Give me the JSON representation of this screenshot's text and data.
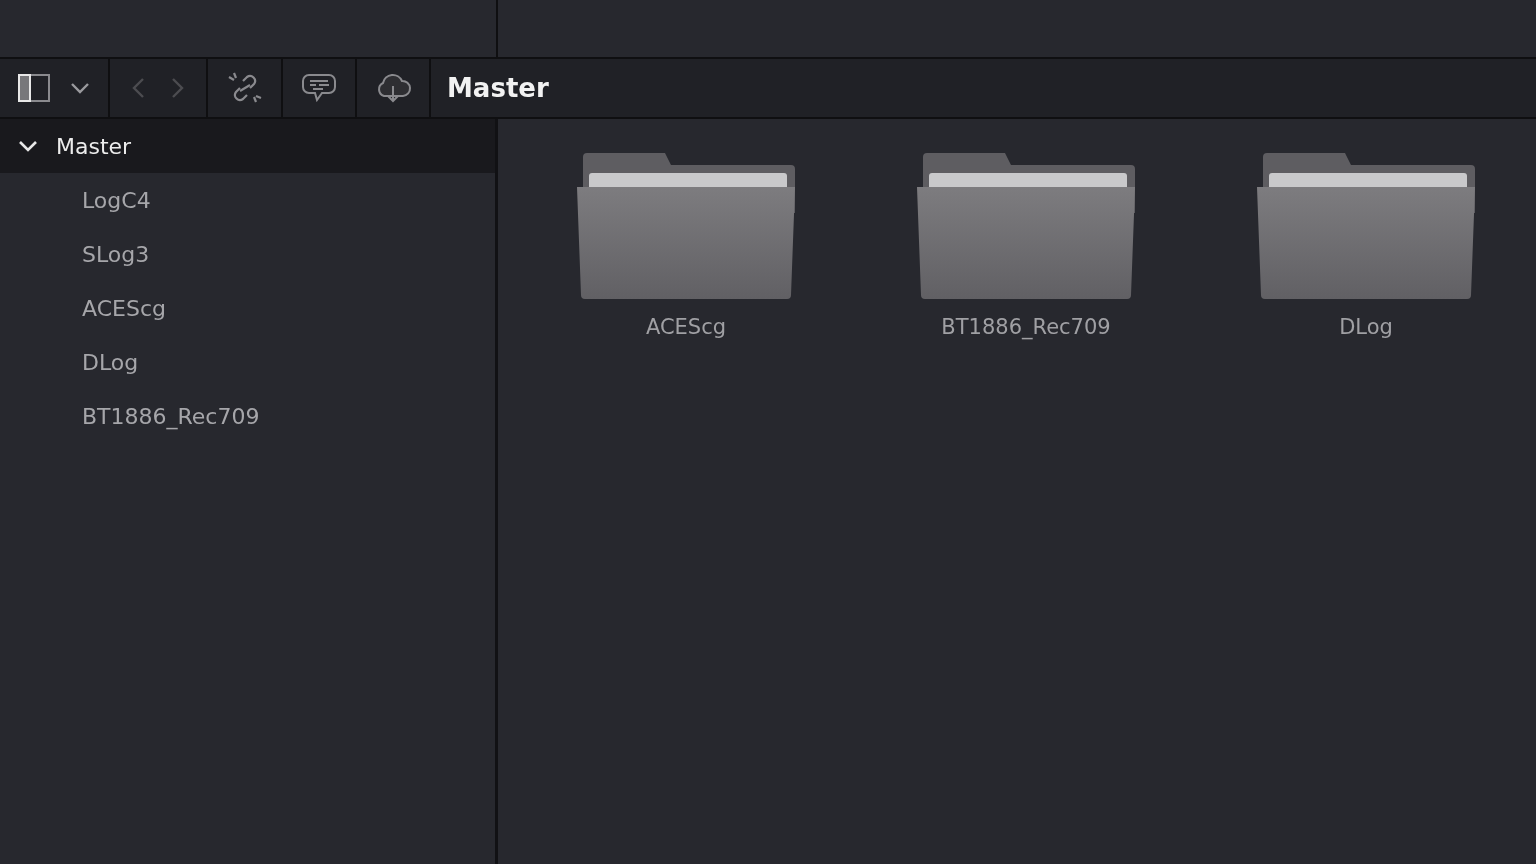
{
  "toolbar": {
    "back": {
      "disabled": true
    },
    "forward": {
      "disabled": true
    },
    "title": "Master"
  },
  "tree": {
    "label": "Master",
    "expanded": true,
    "selected": true,
    "children": [
      {
        "label": "LogC4",
        "selected": false
      },
      {
        "label": "SLog3",
        "selected": false
      },
      {
        "label": "ACEScg",
        "selected": false
      },
      {
        "label": "DLog",
        "selected": false
      },
      {
        "label": "BT1886_Rec709",
        "selected": false
      }
    ]
  },
  "folders": [
    {
      "name": "ACEScg"
    },
    {
      "name": "BT1886_Rec709"
    },
    {
      "name": "DLog"
    }
  ]
}
